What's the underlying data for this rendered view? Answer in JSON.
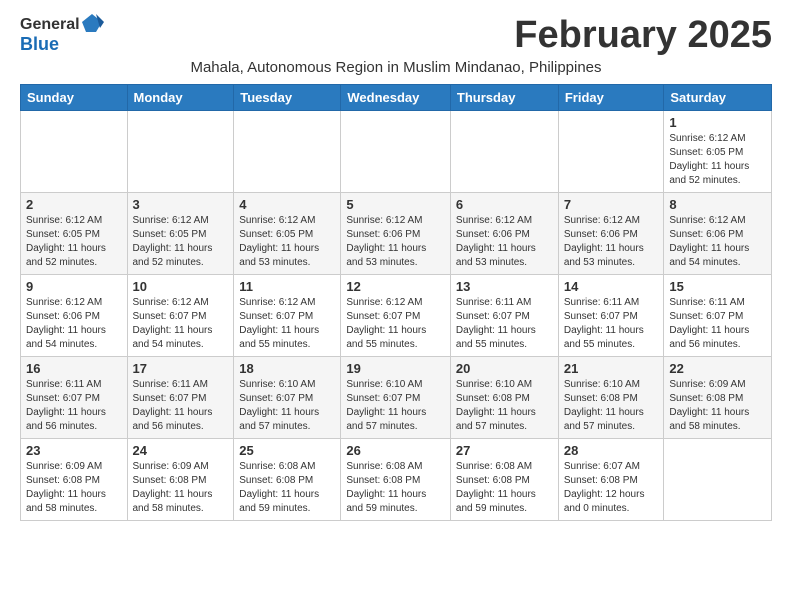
{
  "header": {
    "logo_general": "General",
    "logo_blue": "Blue",
    "month_title": "February 2025",
    "location": "Mahala, Autonomous Region in Muslim Mindanao, Philippines"
  },
  "weekdays": [
    "Sunday",
    "Monday",
    "Tuesday",
    "Wednesday",
    "Thursday",
    "Friday",
    "Saturday"
  ],
  "weeks": [
    [
      {
        "day": "",
        "info": ""
      },
      {
        "day": "",
        "info": ""
      },
      {
        "day": "",
        "info": ""
      },
      {
        "day": "",
        "info": ""
      },
      {
        "day": "",
        "info": ""
      },
      {
        "day": "",
        "info": ""
      },
      {
        "day": "1",
        "info": "Sunrise: 6:12 AM\nSunset: 6:05 PM\nDaylight: 11 hours and 52 minutes."
      }
    ],
    [
      {
        "day": "2",
        "info": "Sunrise: 6:12 AM\nSunset: 6:05 PM\nDaylight: 11 hours and 52 minutes."
      },
      {
        "day": "3",
        "info": "Sunrise: 6:12 AM\nSunset: 6:05 PM\nDaylight: 11 hours and 52 minutes."
      },
      {
        "day": "4",
        "info": "Sunrise: 6:12 AM\nSunset: 6:05 PM\nDaylight: 11 hours and 53 minutes."
      },
      {
        "day": "5",
        "info": "Sunrise: 6:12 AM\nSunset: 6:06 PM\nDaylight: 11 hours and 53 minutes."
      },
      {
        "day": "6",
        "info": "Sunrise: 6:12 AM\nSunset: 6:06 PM\nDaylight: 11 hours and 53 minutes."
      },
      {
        "day": "7",
        "info": "Sunrise: 6:12 AM\nSunset: 6:06 PM\nDaylight: 11 hours and 53 minutes."
      },
      {
        "day": "8",
        "info": "Sunrise: 6:12 AM\nSunset: 6:06 PM\nDaylight: 11 hours and 54 minutes."
      }
    ],
    [
      {
        "day": "9",
        "info": "Sunrise: 6:12 AM\nSunset: 6:06 PM\nDaylight: 11 hours and 54 minutes."
      },
      {
        "day": "10",
        "info": "Sunrise: 6:12 AM\nSunset: 6:07 PM\nDaylight: 11 hours and 54 minutes."
      },
      {
        "day": "11",
        "info": "Sunrise: 6:12 AM\nSunset: 6:07 PM\nDaylight: 11 hours and 55 minutes."
      },
      {
        "day": "12",
        "info": "Sunrise: 6:12 AM\nSunset: 6:07 PM\nDaylight: 11 hours and 55 minutes."
      },
      {
        "day": "13",
        "info": "Sunrise: 6:11 AM\nSunset: 6:07 PM\nDaylight: 11 hours and 55 minutes."
      },
      {
        "day": "14",
        "info": "Sunrise: 6:11 AM\nSunset: 6:07 PM\nDaylight: 11 hours and 55 minutes."
      },
      {
        "day": "15",
        "info": "Sunrise: 6:11 AM\nSunset: 6:07 PM\nDaylight: 11 hours and 56 minutes."
      }
    ],
    [
      {
        "day": "16",
        "info": "Sunrise: 6:11 AM\nSunset: 6:07 PM\nDaylight: 11 hours and 56 minutes."
      },
      {
        "day": "17",
        "info": "Sunrise: 6:11 AM\nSunset: 6:07 PM\nDaylight: 11 hours and 56 minutes."
      },
      {
        "day": "18",
        "info": "Sunrise: 6:10 AM\nSunset: 6:07 PM\nDaylight: 11 hours and 57 minutes."
      },
      {
        "day": "19",
        "info": "Sunrise: 6:10 AM\nSunset: 6:07 PM\nDaylight: 11 hours and 57 minutes."
      },
      {
        "day": "20",
        "info": "Sunrise: 6:10 AM\nSunset: 6:08 PM\nDaylight: 11 hours and 57 minutes."
      },
      {
        "day": "21",
        "info": "Sunrise: 6:10 AM\nSunset: 6:08 PM\nDaylight: 11 hours and 57 minutes."
      },
      {
        "day": "22",
        "info": "Sunrise: 6:09 AM\nSunset: 6:08 PM\nDaylight: 11 hours and 58 minutes."
      }
    ],
    [
      {
        "day": "23",
        "info": "Sunrise: 6:09 AM\nSunset: 6:08 PM\nDaylight: 11 hours and 58 minutes."
      },
      {
        "day": "24",
        "info": "Sunrise: 6:09 AM\nSunset: 6:08 PM\nDaylight: 11 hours and 58 minutes."
      },
      {
        "day": "25",
        "info": "Sunrise: 6:08 AM\nSunset: 6:08 PM\nDaylight: 11 hours and 59 minutes."
      },
      {
        "day": "26",
        "info": "Sunrise: 6:08 AM\nSunset: 6:08 PM\nDaylight: 11 hours and 59 minutes."
      },
      {
        "day": "27",
        "info": "Sunrise: 6:08 AM\nSunset: 6:08 PM\nDaylight: 11 hours and 59 minutes."
      },
      {
        "day": "28",
        "info": "Sunrise: 6:07 AM\nSunset: 6:08 PM\nDaylight: 12 hours and 0 minutes."
      },
      {
        "day": "",
        "info": ""
      }
    ]
  ]
}
